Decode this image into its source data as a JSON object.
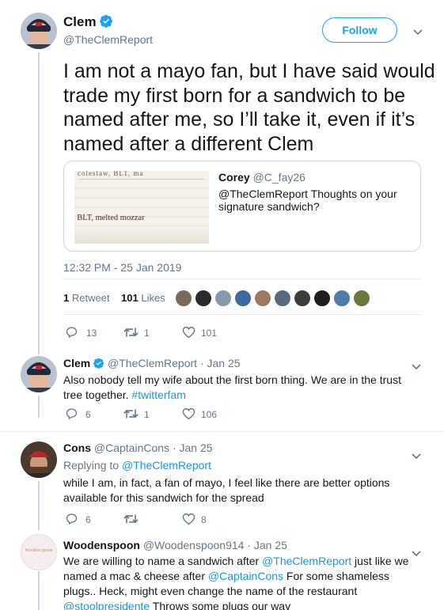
{
  "main": {
    "name": "Clem",
    "handle": "@TheClemReport",
    "follow_label": "Follow",
    "text": "I am not a mayo fan, but I have said would trade my first born for a sandwich to be named after me, so I’ll take it, even if it’s named after a different Clem",
    "quote": {
      "name": "Corey",
      "handle": "@C_fay26",
      "text": "@TheClemReport Thoughts on your signature sandwich?",
      "image_text_top": "coleslaw, BLT, ma",
      "image_text": ", BLT, melted mozzar"
    },
    "timestamp": "12:32 PM - 25 Jan 2019",
    "stats": {
      "retweets_count": "1",
      "retweets_label": "Retweet",
      "likes_count": "101",
      "likes_label": "Likes"
    },
    "actions": {
      "replies": "13",
      "retweets": "1",
      "likes": "101"
    }
  },
  "replies": [
    {
      "name": "Clem",
      "handle": "@TheClemReport",
      "date": "· Jan 25",
      "text": "Also nobody tell my wife about the first born thing. We are in the trust tree together.",
      "hashtag": "#twitterfam",
      "actions": {
        "replies": "6",
        "retweets": "1",
        "likes": "106"
      }
    },
    {
      "name": "Cons",
      "handle": "@CaptainCons",
      "date": "· Jan 25",
      "replying_prefix": "Replying to",
      "replying_to": "@TheClemReport",
      "text": "while I am, in fact, a fan of mayo, I feel like there are better options available for this sandwich for the spread",
      "actions": {
        "replies": "6",
        "retweets": "",
        "likes": "8"
      }
    },
    {
      "name": "Woodenspoon",
      "handle": "@Woodenspoon914",
      "date": "· Jan 25",
      "avatar_text": "Wooden spoon",
      "text_parts": [
        "We are willing to name a sandwich after ",
        "@TheClemReport",
        " just like we named a mac & cheese after ",
        "@CaptainCons",
        " For some shameless plugs.. Heck, might even change the name of the restaurant ",
        "@stoolpresidente",
        " Throws some plugs our way"
      ]
    }
  ],
  "colors": {
    "accent": "#1da1f2",
    "link": "#1b95e0",
    "secondary_text": "#657786",
    "border": "#e6ecf0"
  }
}
